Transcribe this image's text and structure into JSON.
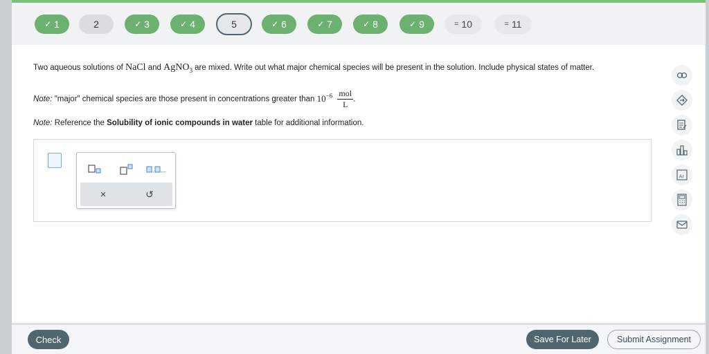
{
  "colors": {
    "done": "#6db170",
    "primary_button": "#4f6670",
    "accent_top": "#7bbf7d"
  },
  "question_nav": [
    {
      "num": "1",
      "state": "done",
      "mark": "✓"
    },
    {
      "num": "2",
      "state": "plain",
      "mark": ""
    },
    {
      "num": "3",
      "state": "done",
      "mark": "✓"
    },
    {
      "num": "4",
      "state": "done",
      "mark": "✓"
    },
    {
      "num": "5",
      "state": "current",
      "mark": ""
    },
    {
      "num": "6",
      "state": "done",
      "mark": "✓"
    },
    {
      "num": "7",
      "state": "done",
      "mark": "✓"
    },
    {
      "num": "8",
      "state": "done",
      "mark": "✓"
    },
    {
      "num": "9",
      "state": "done",
      "mark": "✓"
    },
    {
      "num": "10",
      "state": "partial",
      "mark": "="
    },
    {
      "num": "11",
      "state": "partial",
      "mark": "="
    }
  ],
  "question": {
    "p1_pre": "Two aqueous solutions of ",
    "chem1": "NaCl",
    "p1_and": " and ",
    "chem2_main": "AgNO",
    "chem2_sub": "3",
    "p1_post": " are mixed. Write out what major chemical species will be present in the solution. Include physical states of matter.",
    "note_label": "Note:",
    "note1_text": " \"major\" chemical species are those present in concentrations greater than ",
    "conc_base": "10",
    "conc_exp": "−6",
    "frac_num": "mol",
    "frac_den": "L",
    "note1_end": ".",
    "note2_pre": " Reference the ",
    "note2_bold": "Solubility of ionic compounds in water",
    "note2_post": " table for additional information."
  },
  "palette": {
    "clear_symbol": "×",
    "undo_symbol": "↺"
  },
  "side_tools": [
    "link-icon",
    "tag-icon",
    "notes-icon",
    "chart-icon",
    "periodic-table-icon",
    "calculator-icon",
    "mail-icon"
  ],
  "footer": {
    "check_label": "Check",
    "save_label": "Save For Later",
    "submit_label": "Submit Assignment"
  }
}
